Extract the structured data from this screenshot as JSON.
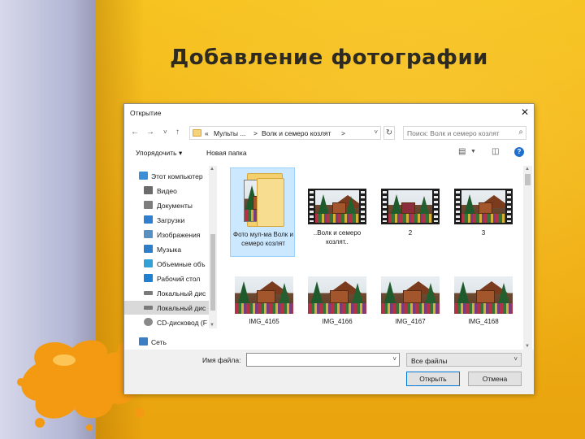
{
  "slide": {
    "title": "Добавление фотографии"
  },
  "dialog": {
    "title": "Открытие",
    "address": {
      "back": "←",
      "forward": "→",
      "recent": "˅",
      "up": "↑",
      "crumbs": [
        "«",
        "Мульты ...",
        ">",
        "Волк и семеро козлят",
        ">"
      ],
      "refresh": "↻",
      "search_placeholder": "Поиск: Волк и семеро козлят"
    },
    "toolbar": {
      "organize": "Упорядочить ▾",
      "new_folder": "Новая папка",
      "view_icon": "view-icon",
      "help": "?"
    },
    "nav": [
      {
        "label": "Этот компьютер",
        "icon": "computer-icon",
        "color": "#3c8fd6"
      },
      {
        "label": "Видео",
        "icon": "video-icon",
        "color": "#6b6b6b"
      },
      {
        "label": "Документы",
        "icon": "documents-icon",
        "color": "#7d7d7d"
      },
      {
        "label": "Загрузки",
        "icon": "downloads-icon",
        "color": "#2f7fd0"
      },
      {
        "label": "Изображения",
        "icon": "pictures-icon",
        "color": "#5a8fc2"
      },
      {
        "label": "Музыка",
        "icon": "music-icon",
        "color": "#2d7ec9"
      },
      {
        "label": "Объемные объ",
        "icon": "3d-objects-icon",
        "color": "#33a0d8"
      },
      {
        "label": "Рабочий стол",
        "icon": "desktop-icon",
        "color": "#1f7fd0"
      },
      {
        "label": "Локальный дис",
        "icon": "drive-icon",
        "color": "#7a7a7a"
      },
      {
        "label": "Локальный дис",
        "icon": "drive-icon",
        "color": "#7a7a7a",
        "selected": true
      },
      {
        "label": "CD-дисковод (F",
        "icon": "cd-drive-icon",
        "color": "#8a8a8a"
      },
      {
        "label": "Сеть",
        "icon": "network-icon",
        "color": "#3a7fc4"
      }
    ],
    "files": [
      {
        "label": "Фото мул-ма Волк и семеро козлят",
        "kind": "folder",
        "selected": true
      },
      {
        "label": "..Волк и семеро козлят..",
        "kind": "video"
      },
      {
        "label": "2",
        "kind": "video"
      },
      {
        "label": "3",
        "kind": "video"
      },
      {
        "label": "IMG_4165",
        "kind": "image"
      },
      {
        "label": "IMG_4166",
        "kind": "image"
      },
      {
        "label": "IMG_4167",
        "kind": "image"
      },
      {
        "label": "IMG_4168",
        "kind": "image"
      }
    ],
    "bottom": {
      "filename_label": "Имя файла:",
      "filename_value": "",
      "filetype": "Все файлы",
      "open": "Открыть",
      "cancel": "Отмена"
    }
  }
}
